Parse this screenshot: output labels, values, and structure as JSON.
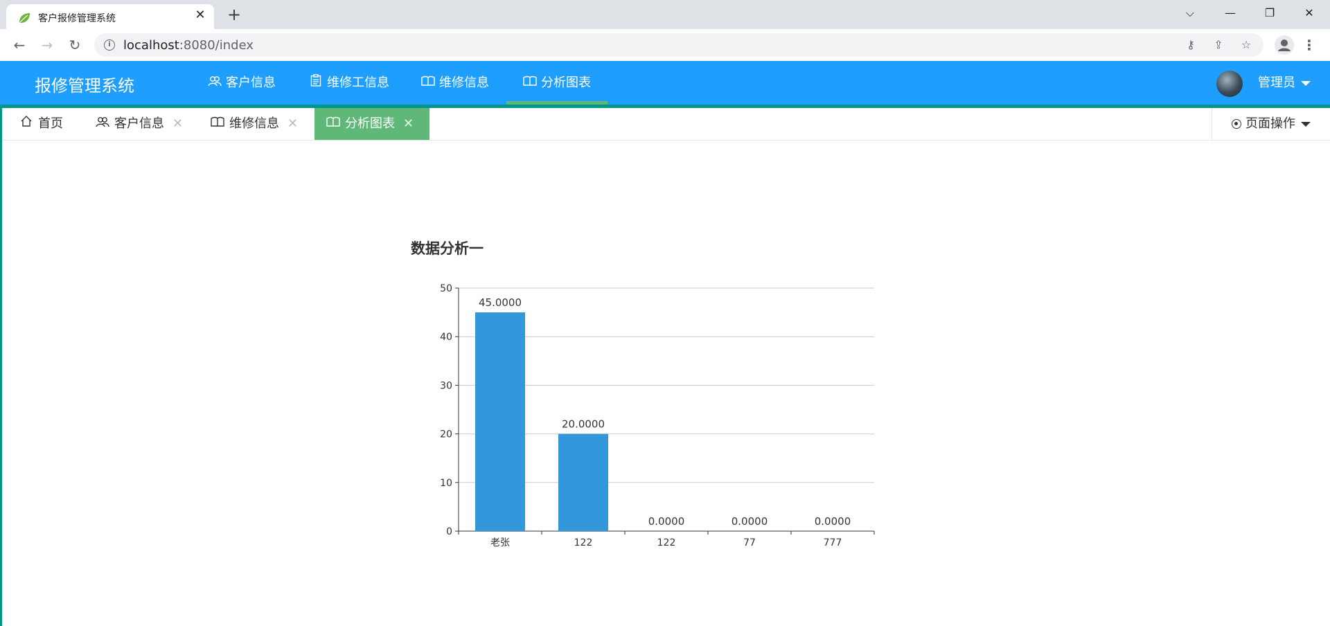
{
  "browser": {
    "tab_title": "客户报修管理系统",
    "url_host": "localhost",
    "url_rest": ":8080/index"
  },
  "header": {
    "brand": "报修管理系统",
    "nav": [
      {
        "label": "客户信息",
        "icon": "users-icon"
      },
      {
        "label": "维修工信息",
        "icon": "clipboard-icon"
      },
      {
        "label": "维修信息",
        "icon": "book-icon"
      },
      {
        "label": "分析图表",
        "icon": "book-icon"
      }
    ],
    "user": "管理员"
  },
  "tabs": [
    {
      "label": "首页",
      "icon": "home-icon"
    },
    {
      "label": "客户信息",
      "icon": "users-icon"
    },
    {
      "label": "维修信息",
      "icon": "book-icon"
    },
    {
      "label": "分析图表",
      "icon": "book-icon"
    }
  ],
  "page_ops": "页面操作",
  "colors": {
    "header": "#1e9fff",
    "active_tab": "#5fb878",
    "accent": "#009688",
    "bar": "#3398db"
  },
  "chart_data": {
    "type": "bar",
    "title": "数据分析一",
    "categories": [
      "老张",
      "122",
      "122",
      "77",
      "777"
    ],
    "values": [
      45,
      20,
      0,
      0,
      0
    ],
    "value_labels": [
      "45.0000",
      "20.0000",
      "0.0000",
      "0.0000",
      "0.0000"
    ],
    "yticks": [
      0,
      10,
      20,
      30,
      40,
      50
    ],
    "ylim": [
      0,
      50
    ],
    "grid": true,
    "xlabel": "",
    "ylabel": ""
  }
}
